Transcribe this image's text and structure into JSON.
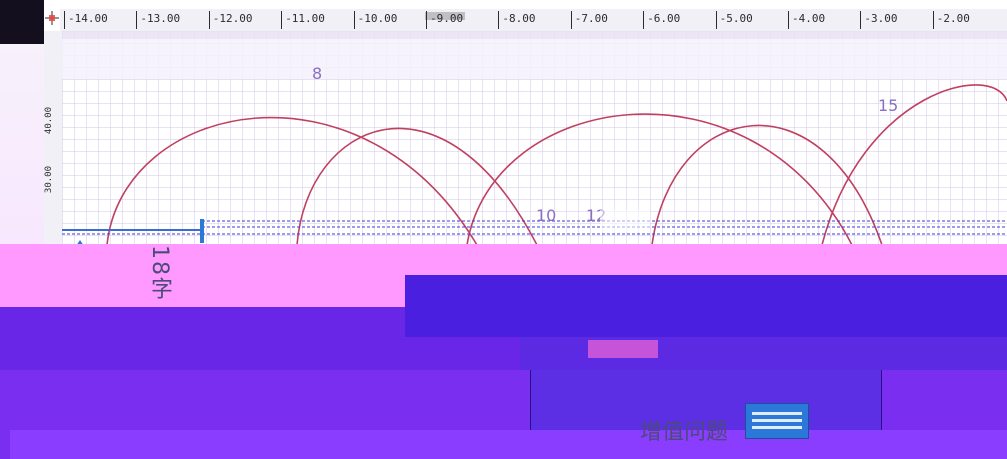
{
  "ruler": {
    "ticks": [
      "-14.00",
      "-13.00",
      "-12.00",
      "-11.00",
      "-10.00",
      "-9.00",
      "-8.00",
      "-7.00",
      "-6.00",
      "-5.00",
      "-4.00",
      "-3.00",
      "-2.00"
    ],
    "vertical": [
      "40.00",
      "30.00"
    ]
  },
  "markers": {
    "left_top": "8",
    "right_top": "15",
    "mid_left": "10",
    "mid_right": "12"
  },
  "text": {
    "vertical_chars": "18字",
    "caption": "增值问题"
  },
  "colors": {
    "grid_bg": "#ffffff",
    "grid_line": "#cfc7ea",
    "arc": "#c04060",
    "accent_blue": "#2b78d8",
    "pink": "#ff99ff",
    "purple": "#6a26e6"
  },
  "icons": [
    "corner-crosshair-icon",
    "ruler-arrow-icon",
    "badge-icon"
  ]
}
